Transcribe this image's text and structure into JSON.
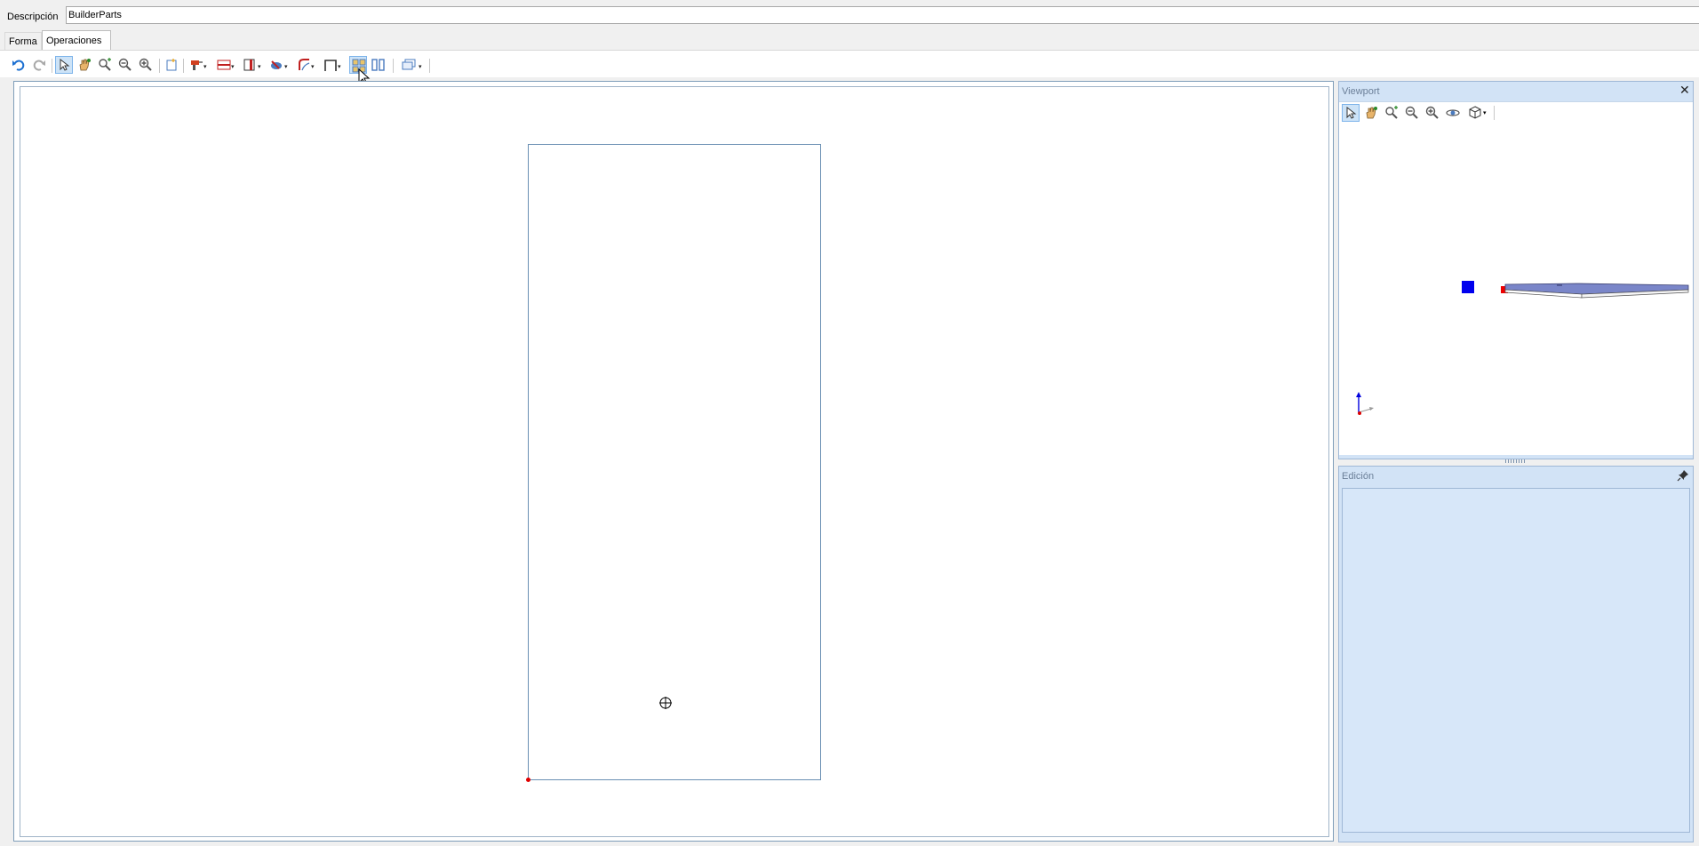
{
  "description": {
    "label": "Descripción",
    "value": "BuilderParts"
  },
  "tabs": [
    {
      "label": "Forma",
      "active": false
    },
    {
      "label": "Operaciones",
      "active": true
    }
  ],
  "toolbar": {
    "items": [
      {
        "icon": "undo-icon"
      },
      {
        "icon": "redo-icon"
      },
      {
        "icon": "select-pointer-icon",
        "active": true
      },
      {
        "icon": "pan-hand-icon"
      },
      {
        "icon": "zoom-window-icon"
      },
      {
        "icon": "zoom-out-icon"
      },
      {
        "icon": "zoom-in-icon"
      },
      {
        "icon": "new-document-icon"
      },
      {
        "icon": "drill-icon",
        "dropdown": true
      },
      {
        "icon": "groove-icon",
        "dropdown": true
      },
      {
        "icon": "pocket-icon",
        "dropdown": true
      },
      {
        "icon": "milling-icon",
        "dropdown": true
      },
      {
        "icon": "curve-path-icon",
        "dropdown": true
      },
      {
        "icon": "frame-icon",
        "dropdown": true
      },
      {
        "icon": "grid-view-icon",
        "active": true
      },
      {
        "icon": "columns-icon"
      },
      {
        "icon": "layers-icon",
        "dropdown": true
      }
    ]
  },
  "viewport": {
    "title": "Viewport",
    "close_glyph": "✕",
    "toolbar": [
      {
        "icon": "select-pointer-icon",
        "active": true
      },
      {
        "icon": "pan-hand-icon"
      },
      {
        "icon": "zoom-window-icon"
      },
      {
        "icon": "zoom-out-icon"
      },
      {
        "icon": "zoom-in-icon"
      },
      {
        "icon": "orbit-icon"
      },
      {
        "icon": "cube-view-icon",
        "dropdown": true
      }
    ]
  },
  "edicion": {
    "title": "Edición"
  },
  "colors": {
    "panel_bg": "#d2e3f6",
    "part_outline": "#6a8fb3",
    "origin": "#e00000",
    "marker_blue": "#0000ee"
  }
}
